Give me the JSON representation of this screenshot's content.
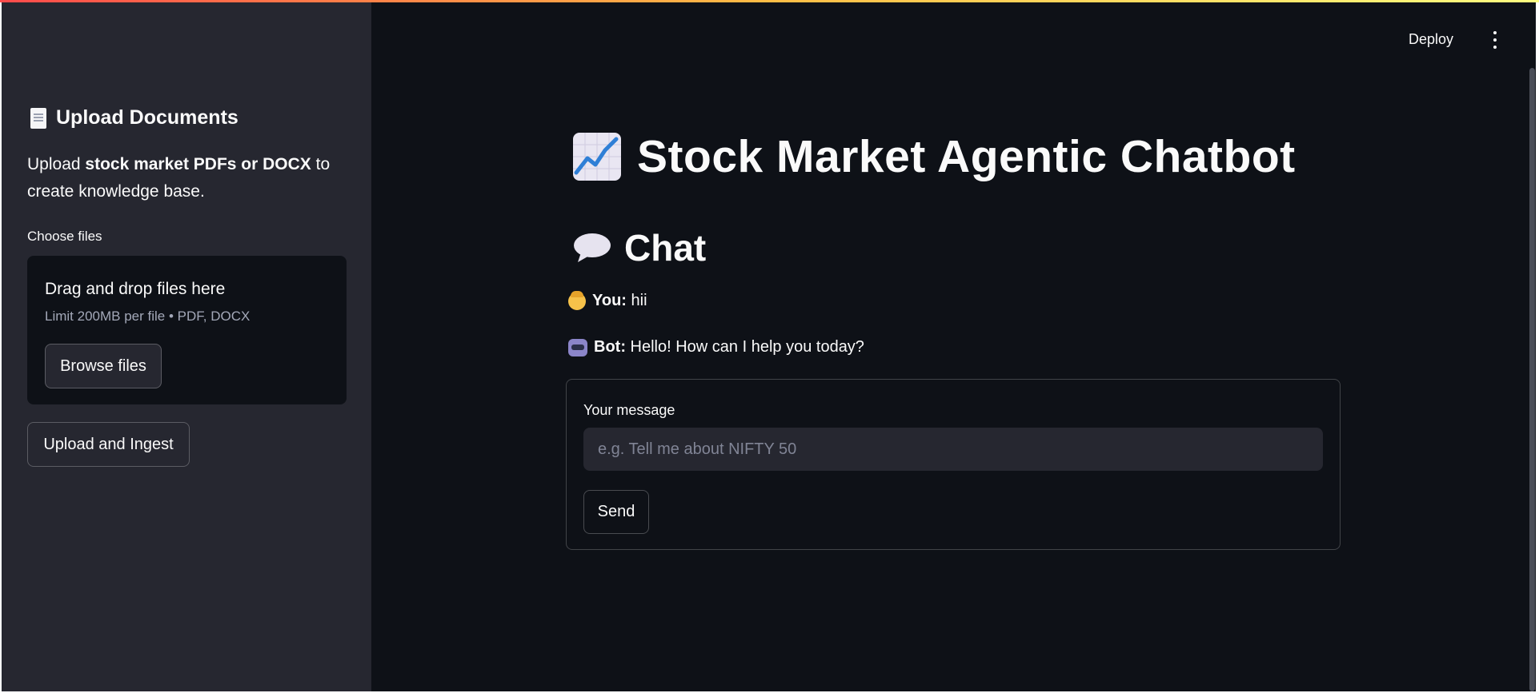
{
  "header": {
    "deploy_label": "Deploy",
    "menu_icon": "vertical-ellipsis-icon"
  },
  "sidebar": {
    "title_icon": "document-icon",
    "title": "Upload Documents",
    "desc_prefix": "Upload ",
    "desc_bold": "stock market PDFs or DOCX",
    "desc_suffix": " to create knowledge base.",
    "choose_label": "Choose files",
    "dropzone": {
      "title": "Drag and drop files here",
      "limit": "Limit 200MB per file • PDF, DOCX",
      "browse_label": "Browse files"
    },
    "upload_button": "Upload and Ingest"
  },
  "main": {
    "title_icon": "chart-increasing-icon",
    "title": "Stock Market Agentic Chatbot",
    "chat_icon": "speech-bubble-icon",
    "chat_heading": "Chat",
    "messages": [
      {
        "icon": "person-icon",
        "speaker": "You:",
        "text": " hii"
      },
      {
        "icon": "robot-icon",
        "speaker": "Bot:",
        "text": " Hello! How can I help you today?"
      }
    ],
    "form": {
      "label": "Your message",
      "placeholder": "e.g. Tell me about NIFTY 50",
      "value": "",
      "send_label": "Send"
    }
  },
  "colors": {
    "background": "#0e1117",
    "sidebar": "#262730",
    "text": "#fafafa",
    "input_bg": "#262730"
  }
}
